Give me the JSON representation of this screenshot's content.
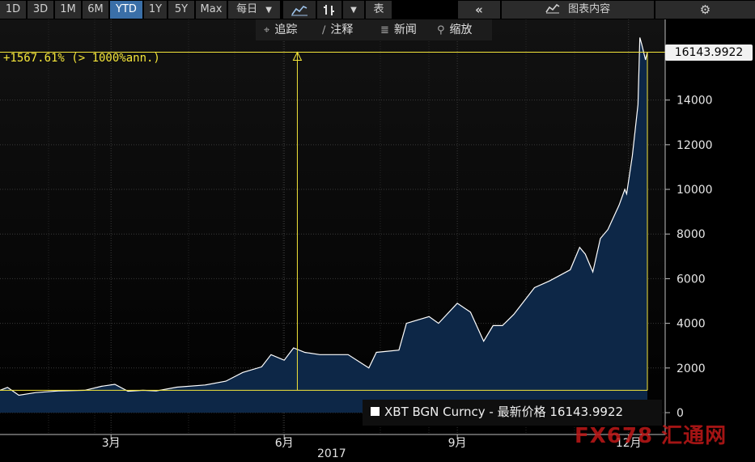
{
  "toolbar": {
    "ranges": [
      "1D",
      "3D",
      "1M",
      "6M",
      "YTD",
      "1Y",
      "5Y",
      "Max"
    ],
    "active_range": "YTD",
    "frequency": "每日",
    "table_label": "表",
    "chart_content_label": "图表内容"
  },
  "subtoolbar": {
    "track": "追踪",
    "annotate": "注释",
    "news": "新闻",
    "zoom": "缩放"
  },
  "annotation": "+1567.61% (> 1000%ann.)",
  "last_price_tag": "16143.9922",
  "legend": {
    "series_label": "XBT BGN Curncy - 最新价格 16143.9922"
  },
  "year_label": "2017",
  "watermark": "FX678 汇通网",
  "colors": {
    "background": "#000000",
    "area_fill": "#0d2747",
    "line": "#ffffff",
    "annotation": "#f5e63a",
    "active_tab": "#3a6fa8"
  },
  "chart_data": {
    "type": "area",
    "series": [
      {
        "name": "XBT BGN Curncy",
        "x": [
          "2017-01-01",
          "2017-01-05",
          "2017-01-11",
          "2017-01-20",
          "2017-02-01",
          "2017-02-15",
          "2017-02-24",
          "2017-03-03",
          "2017-03-10",
          "2017-03-18",
          "2017-03-25",
          "2017-04-05",
          "2017-04-20",
          "2017-05-01",
          "2017-05-10",
          "2017-05-20",
          "2017-05-25",
          "2017-06-01",
          "2017-06-06",
          "2017-06-12",
          "2017-06-20",
          "2017-06-28",
          "2017-07-05",
          "2017-07-16",
          "2017-07-20",
          "2017-08-01",
          "2017-08-05",
          "2017-08-13",
          "2017-08-17",
          "2017-08-22",
          "2017-09-01",
          "2017-09-08",
          "2017-09-15",
          "2017-09-20",
          "2017-09-25",
          "2017-10-01",
          "2017-10-12",
          "2017-10-20",
          "2017-10-31",
          "2017-11-05",
          "2017-11-08",
          "2017-11-12",
          "2017-11-16",
          "2017-11-20",
          "2017-11-26",
          "2017-11-29",
          "2017-11-30",
          "2017-12-03",
          "2017-12-06",
          "2017-12-07",
          "2017-12-08",
          "2017-12-10",
          "2017-12-11"
        ],
        "values": [
          1000,
          1130,
          780,
          900,
          970,
          1000,
          1180,
          1270,
          960,
          1000,
          970,
          1140,
          1240,
          1410,
          1800,
          2050,
          2600,
          2350,
          2900,
          2700,
          2600,
          2600,
          2600,
          2000,
          2700,
          2800,
          4000,
          4200,
          4300,
          4000,
          4900,
          4500,
          3200,
          3900,
          3900,
          4400,
          5600,
          5900,
          6400,
          7400,
          7100,
          6300,
          7800,
          8200,
          9300,
          10000,
          9800,
          11500,
          13800,
          16800,
          16500,
          15800,
          16143.9922
        ]
      }
    ],
    "xlabel": "2017",
    "x_tick_labels": [
      "3月",
      "6月",
      "9月",
      "12月"
    ],
    "y_tick_labels": [
      "0",
      "2000",
      "4000",
      "6000",
      "8000",
      "10000",
      "12000",
      "14000"
    ],
    "ylim": [
      0,
      18000
    ],
    "grid": true,
    "reference": {
      "start_date": "2017-06-08",
      "start_value": 1000,
      "end_date": "2017-12-11",
      "end_value": 16143.9922,
      "change_label": "+1567.61% (> 1000%ann.)"
    }
  }
}
